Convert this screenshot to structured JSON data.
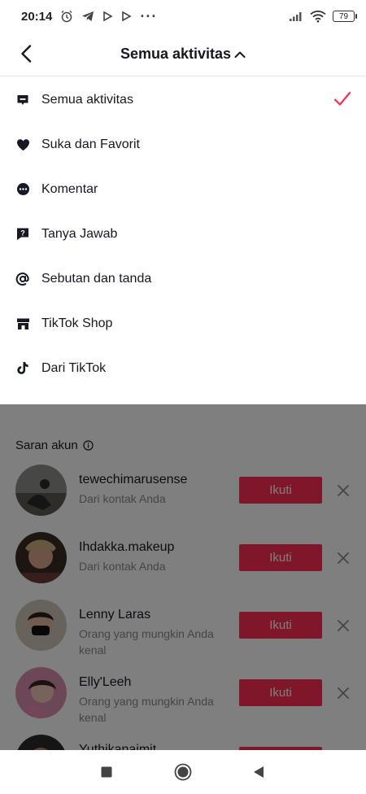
{
  "status_bar": {
    "time": "20:14",
    "icons": [
      "alarm-icon",
      "telegram-icon",
      "play-icon",
      "play-icon",
      "more-dots-icon"
    ],
    "battery": "79"
  },
  "header": {
    "title": "Semua aktivitas",
    "back_icon": "chevron-left-icon",
    "toggle_icon": "chevron-up-icon"
  },
  "menu": {
    "items": [
      {
        "label": "Semua aktivitas",
        "icon": "message-square-icon",
        "selected": true
      },
      {
        "label": "Suka dan Favorit",
        "icon": "heart-icon",
        "selected": false
      },
      {
        "label": "Komentar",
        "icon": "comment-dots-icon",
        "selected": false
      },
      {
        "label": "Tanya Jawab",
        "icon": "question-bubble-icon",
        "selected": false
      },
      {
        "label": "Sebutan dan tanda",
        "icon": "at-sign-icon",
        "selected": false
      },
      {
        "label": "TikTok Shop",
        "icon": "shop-icon",
        "selected": false
      },
      {
        "label": "Dari TikTok",
        "icon": "tiktok-icon",
        "selected": false
      }
    ],
    "accent": "#fe2c55"
  },
  "suggestions": {
    "title": "Saran akun",
    "follow_label": "Ikuti",
    "accounts": [
      {
        "name": "tewechimarusense",
        "subtitle": "Dari kontak Anda"
      },
      {
        "name": "Ihdakka.makeup",
        "subtitle": "Dari kontak Anda"
      },
      {
        "name": "Lenny Laras",
        "subtitle": "Orang yang mungkin Anda kenal"
      },
      {
        "name": "Elly'Leeh",
        "subtitle": "Orang yang mungkin Anda kenal"
      },
      {
        "name": "Yuthikanaimit",
        "subtitle": ""
      }
    ]
  },
  "nav": {
    "items": [
      "recents-square-icon",
      "home-circle-icon",
      "back-triangle-icon"
    ]
  }
}
